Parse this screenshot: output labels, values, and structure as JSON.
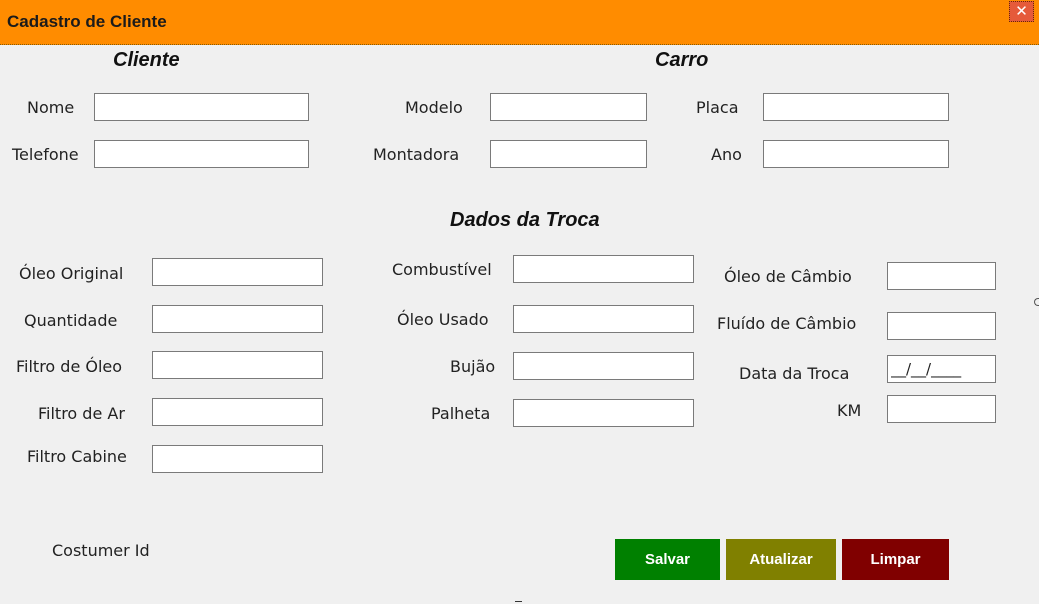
{
  "window": {
    "title": "Cadastro de Cliente",
    "close_glyph": "✕"
  },
  "sections": {
    "cliente": "Cliente",
    "carro": "Carro",
    "troca": "Dados da Troca"
  },
  "cliente": {
    "nome_label": "Nome",
    "telefone_label": "Telefone"
  },
  "carro": {
    "modelo_label": "Modelo",
    "montadora_label": "Montadora",
    "placa_label": "Placa",
    "ano_label": "Ano"
  },
  "troca": {
    "oleo_original_label": "Óleo Original",
    "quantidade_label": "Quantidade",
    "filtro_oleo_label": "Filtro de Óleo",
    "filtro_ar_label": "Filtro de Ar",
    "filtro_cabine_label": "Filtro Cabine",
    "combustivel_label": "Combustível",
    "oleo_usado_label": "Óleo Usado",
    "bujao_label": "Bujão",
    "palheta_label": "Palheta",
    "oleo_cambio_label": "Óleo de Câmbio",
    "fluido_cambio_label": "Fluído de Câmbio",
    "data_troca_label": "Data da Troca",
    "data_troca_mask": "__/__/____",
    "km_label": "KM"
  },
  "footer": {
    "costumer_id_label": "Costumer Id"
  },
  "buttons": {
    "salvar": "Salvar",
    "atualizar": "Atualizar",
    "limpar": "Limpar"
  },
  "colors": {
    "titlebar": "#ff8c00",
    "salvar": "#008000",
    "atualizar": "#808000",
    "limpar": "#800000"
  }
}
